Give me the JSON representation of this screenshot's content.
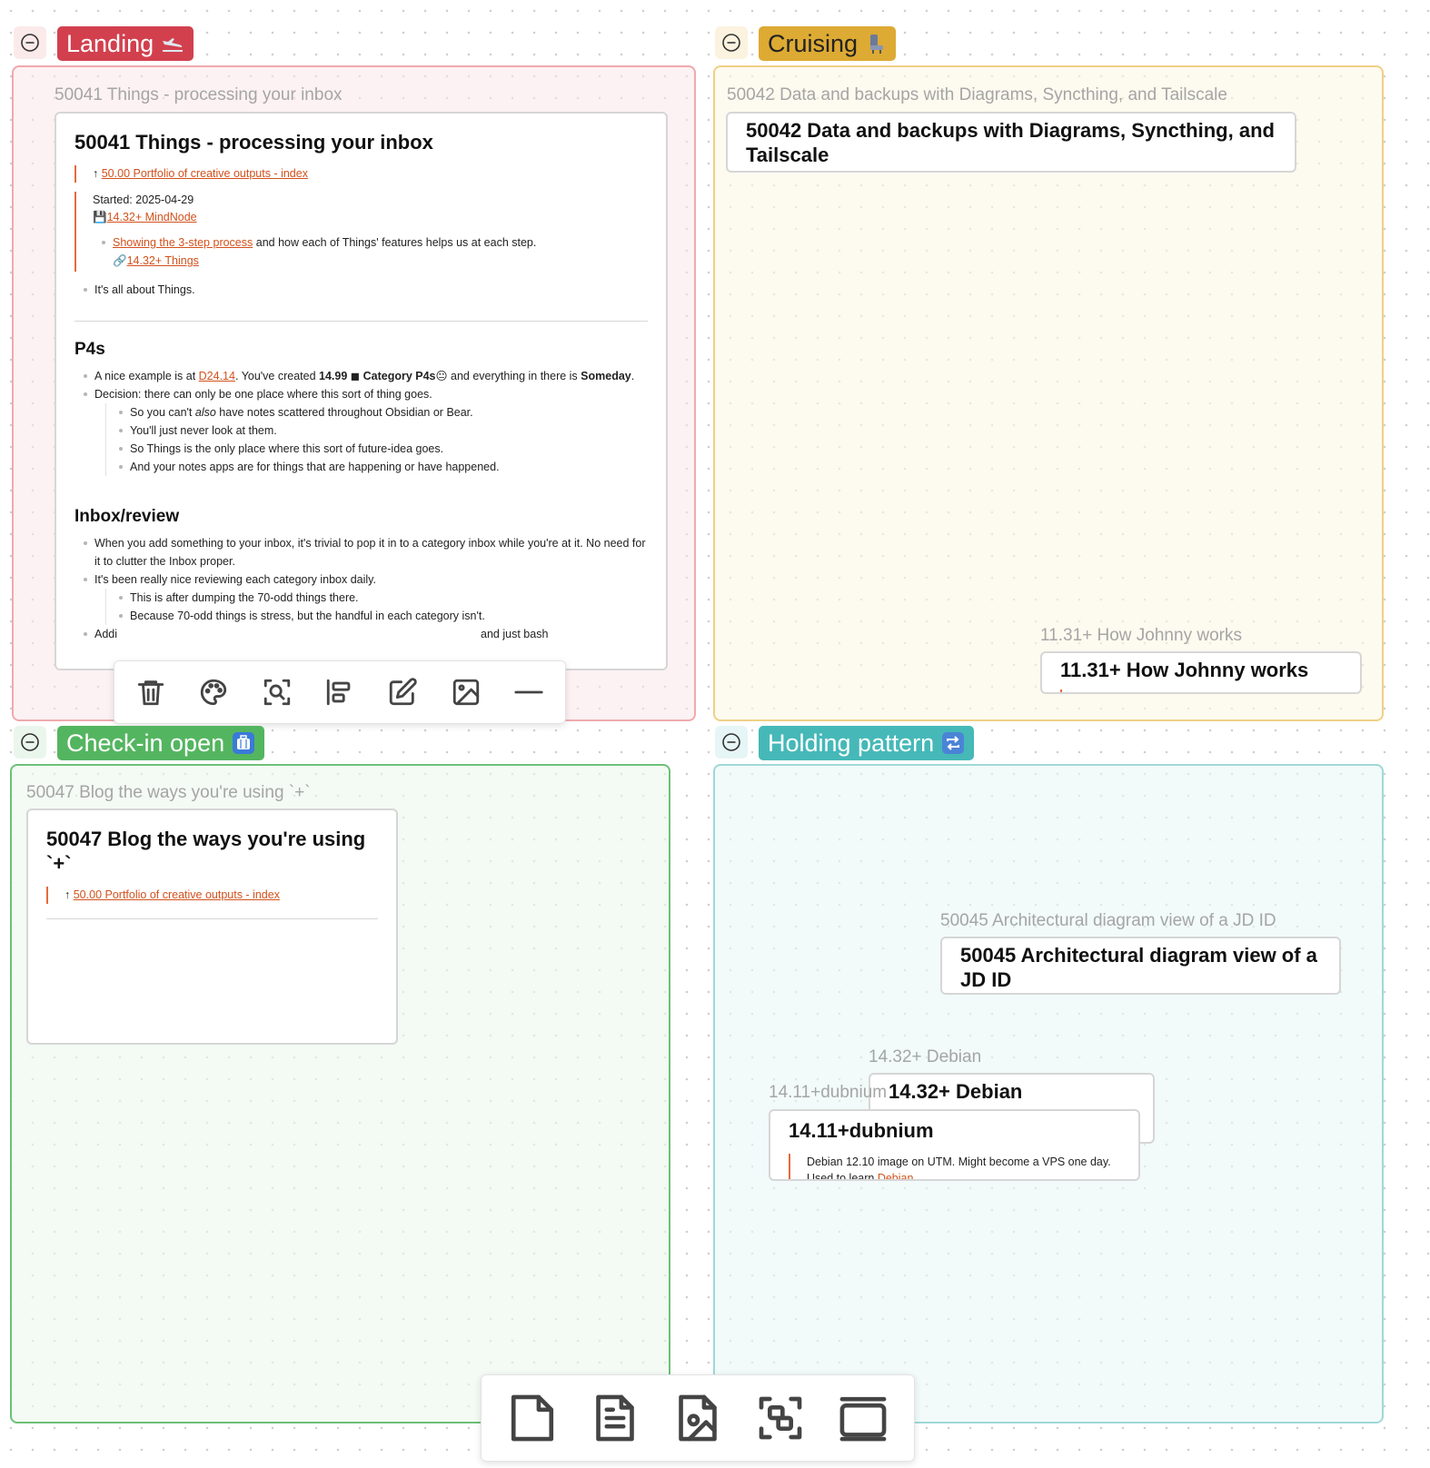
{
  "groups": {
    "landing": {
      "label": "Landing",
      "color": "#d2404e"
    },
    "cruising": {
      "label": "Cruising",
      "color": "#ddaa33"
    },
    "checkin": {
      "label": "Check-in open",
      "color": "#54b560"
    },
    "holding": {
      "label": "Holding pattern",
      "color": "#46b8b8"
    }
  },
  "node_50041": {
    "title": "50041 Things - processing your inbox",
    "heading": "50041 Things - processing your inbox",
    "up_arrow": "↑",
    "parent_link": "50.00 Portfolio of creative outputs - index",
    "started": "Started: 2025-04-29",
    "mindnode_link": "14.32+ MindNode",
    "showing_link": "Showing the 3-step process",
    "showing_rest": " and how each of Things' features helps us at each step.",
    "things_link": "14.32+ Things",
    "about": "It's all about Things.",
    "p4s_heading": "P4s",
    "p4s_b1_a": "A nice example is at ",
    "p4s_b1_link": "D24.14",
    "p4s_b1_b": ". You've created ",
    "p4s_b1_bold1": "14.99 ◼︎ Category P4s",
    "p4s_b1_c": " and everything in there is ",
    "p4s_b1_bold2": "Someday",
    "p4s_b1_d": ".",
    "p4s_b2": "Decision: there can only be one place where this sort of thing goes.",
    "p4s_b2_1a": "So you can't ",
    "p4s_b2_1em": "also",
    "p4s_b2_1b": " have notes scattered throughout Obsidian or Bear.",
    "p4s_b2_2": "You'll just never look at them.",
    "p4s_b2_3": "So Things is the only place where this sort of future-idea goes.",
    "p4s_b2_4": "And your notes apps are for things that are happening or have happened.",
    "inbox_heading": "Inbox/review",
    "inbox_b1": "When you add something to your inbox, it's trivial to pop it in to a category inbox while you're at it. No need for it to clutter the Inbox proper.",
    "inbox_b2": "It's been really nice reviewing each category inbox daily.",
    "inbox_b2_1": "This is after dumping the 70-odd things there.",
    "inbox_b2_2": "Because 70-odd things is stress, but the handful in each category isn't.",
    "inbox_b3_a": "Addi",
    "inbox_b3_b": "and just bash"
  },
  "node_50042": {
    "title": "50042 Data and backups with Diagrams, Syncthing, and Tailscale",
    "heading": "50042 Data and backups with Diagrams, Syncthing, and Tailscale"
  },
  "node_1131": {
    "title": "11.31+ How Johnny works",
    "heading": "11.31+ How Johnny works"
  },
  "node_50047": {
    "title": "50047 Blog the ways you're using `+`",
    "heading": "50047 Blog the ways you're using `+`",
    "up_arrow": "↑",
    "parent_link": "50.00 Portfolio of creative outputs - index"
  },
  "node_50045": {
    "title": "50045 Architectural diagram view of a JD ID",
    "heading": "50045 Architectural diagram view of a JD ID"
  },
  "node_1432_debian": {
    "title": "14.32+ Debian",
    "heading": "14.32+ Debian"
  },
  "node_1411": {
    "title": "14.11+dubnium",
    "heading": "14.11+dubnium",
    "body_a": "Debian 12.10 image on UTM. Might become a VPS one day.",
    "body_b": "Used to learn ",
    "body_link": "Debian",
    "body_c": "."
  },
  "selection_toolbar": [
    "trash-icon",
    "palette-icon",
    "zoom-to-selection-icon",
    "align-icon",
    "edit-icon",
    "image-icon",
    "line-icon"
  ],
  "canvas_toolbar": [
    "new-card-icon",
    "new-note-icon",
    "new-media-icon",
    "new-group-icon",
    "new-frame-icon"
  ]
}
